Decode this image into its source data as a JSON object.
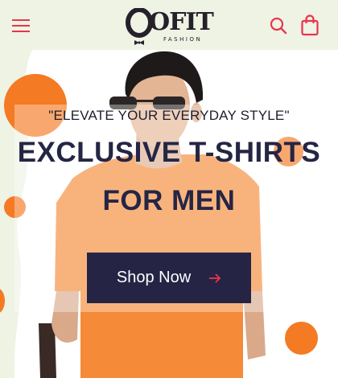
{
  "header": {
    "brand": "OFIT",
    "brand_sub": "FASHION",
    "icons": {
      "menu": "hamburger-menu-icon",
      "search": "search-icon",
      "bag": "shopping-bag-icon"
    }
  },
  "hero": {
    "tagline": "\"ELEVATE YOUR EVERYDAY STYLE\"",
    "headline_line1": "EXCLUSIVE T-SHIRTS",
    "headline_line2": "FOR MEN",
    "cta_label": "Shop Now"
  },
  "colors": {
    "accent": "#e8354b",
    "orange": "#f47a23",
    "navy": "#262445",
    "background": "#eef3e4"
  }
}
